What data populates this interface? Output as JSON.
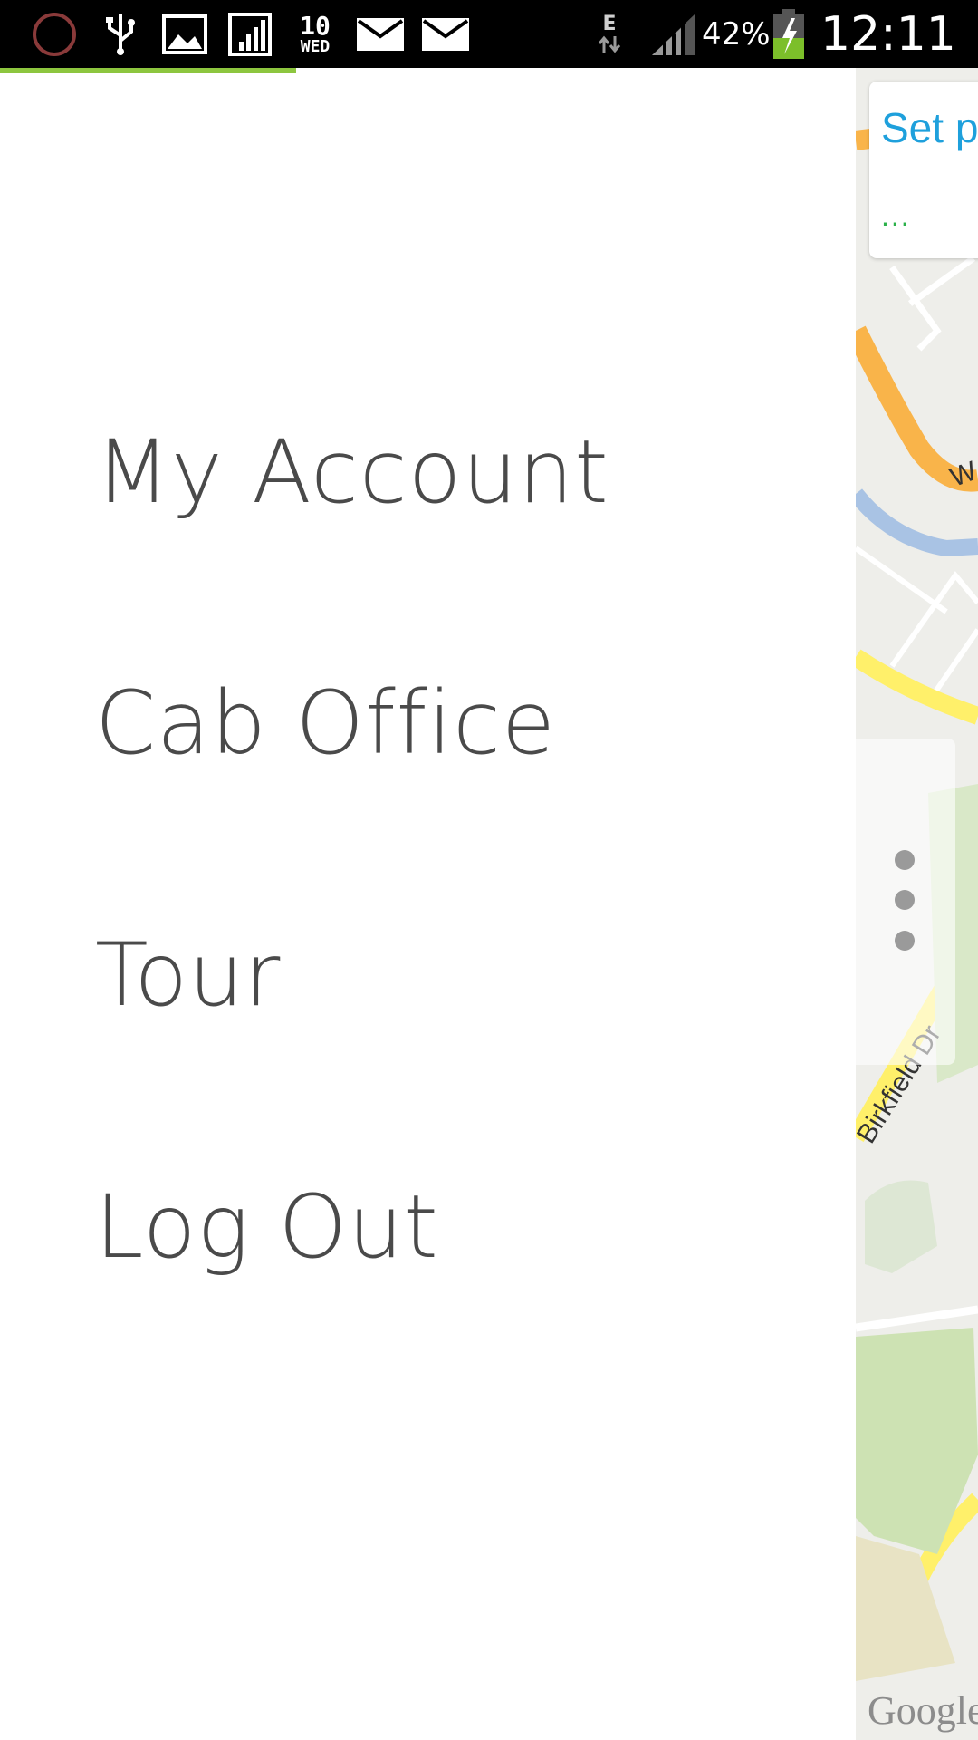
{
  "status_bar": {
    "date_day": "10",
    "date_weekday": "WED",
    "network_type": "E",
    "battery_percent": "42%",
    "time": "12:11",
    "icons": [
      "circle-notification-icon",
      "usb-icon",
      "image-icon",
      "signal-bars-icon",
      "calendar-icon",
      "mail-icon",
      "mail-icon",
      "data-transfer-icon",
      "cell-signal-icon",
      "battery-charging-icon"
    ]
  },
  "drawer": {
    "items": [
      {
        "label": "My Account"
      },
      {
        "label": "Cab Office"
      },
      {
        "label": "Tour"
      },
      {
        "label": "Log Out"
      }
    ]
  },
  "map": {
    "pickup_card_title": "Set p",
    "pickup_card_status": "...",
    "road_label_top": "W",
    "road_label_bottom": "Birkfield Dr",
    "attribution": "Google"
  },
  "colors": {
    "accent_green": "#8dc63f",
    "link_blue": "#1ea0dc",
    "dots_green": "#2bb14a",
    "menu_text": "#4a4a4a"
  }
}
